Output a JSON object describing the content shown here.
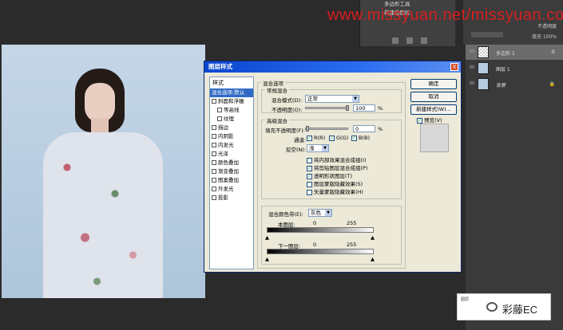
{
  "watermark": "www.missyuan.net/missyuan.com",
  "top_panel": {
    "rows": [
      "多边形工具",
      "新建白图层"
    ]
  },
  "right_top": {
    "opt1": "不透明度",
    "opt2": "填充 100%"
  },
  "layers": [
    {
      "name": "多边形 1",
      "lock": "",
      "active": true
    },
    {
      "name": "图层 1",
      "lock": "",
      "active": false
    },
    {
      "name": "背景",
      "lock": "🔒",
      "active": false
    }
  ],
  "badge": {
    "small": "图层",
    "text": "彩藤EC"
  },
  "dialog": {
    "title": "图层样式",
    "close": "X",
    "styles_header": "样式",
    "styles": [
      {
        "label": "混合选项:默认",
        "sel": true,
        "cb": false,
        "sub": false
      },
      {
        "label": "斜面和浮雕",
        "sel": false,
        "cb": true,
        "sub": false
      },
      {
        "label": "等高线",
        "sel": false,
        "cb": true,
        "sub": true
      },
      {
        "label": "纹理",
        "sel": false,
        "cb": true,
        "sub": true
      },
      {
        "label": "描边",
        "sel": false,
        "cb": true,
        "sub": false
      },
      {
        "label": "内阴影",
        "sel": false,
        "cb": true,
        "sub": false
      },
      {
        "label": "内发光",
        "sel": false,
        "cb": true,
        "sub": false
      },
      {
        "label": "光泽",
        "sel": false,
        "cb": true,
        "sub": false
      },
      {
        "label": "颜色叠加",
        "sel": false,
        "cb": true,
        "sub": false
      },
      {
        "label": "渐变叠加",
        "sel": false,
        "cb": true,
        "sub": false
      },
      {
        "label": "图案叠加",
        "sel": false,
        "cb": true,
        "sub": false
      },
      {
        "label": "外发光",
        "sel": false,
        "cb": true,
        "sub": false
      },
      {
        "label": "投影",
        "sel": false,
        "cb": true,
        "sub": false
      }
    ],
    "blend_options_title": "混合选项",
    "general_blend": {
      "legend": "常规混合",
      "mode_label": "混合模式(D):",
      "mode_value": "正常",
      "opacity_label": "不透明度(O):",
      "opacity_value": "100",
      "opacity_unit": "%"
    },
    "advanced_blend": {
      "legend": "高级混合",
      "fill_label": "填充不透明度(F):",
      "fill_value": "0",
      "fill_unit": "%",
      "channels_label": "通道:",
      "channels": [
        "R(R)",
        "G(G)",
        "B(B)"
      ],
      "knockout_label": "挖空(N):",
      "knockout_value": "浅",
      "options": [
        {
          "label": "将内部效果混合成组(I)",
          "checked": false
        },
        {
          "label": "将剪贴图层混合成组(P)",
          "checked": true
        },
        {
          "label": "透明形状图层(T)",
          "checked": true
        },
        {
          "label": "图层蒙版隐藏效果(S)",
          "checked": false
        },
        {
          "label": "矢量蒙版隐藏效果(H)",
          "checked": false
        }
      ]
    },
    "blend_if": {
      "label": "混合颜色带(E):",
      "value": "灰色",
      "this_layer": "本图层:",
      "this_min": "0",
      "this_max": "255",
      "below_layer": "下一图层:",
      "below_min": "0",
      "below_max": "255"
    },
    "buttons": {
      "ok": "确定",
      "cancel": "取消",
      "new_style": "新建样式(W)...",
      "preview": "预览(V)"
    }
  }
}
